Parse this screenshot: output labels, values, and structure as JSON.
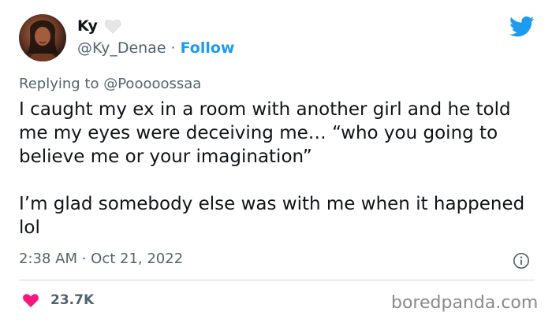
{
  "author": {
    "name": "Ky",
    "handle": "@Ky_Denae",
    "separator": "·",
    "follow_label": "Follow"
  },
  "reply": {
    "prefix": "Replying to",
    "to_handle": "@Pooooossaa"
  },
  "tweet": {
    "text": "I caught my ex in a room with another girl and he told me my eyes were deceiving me… “who you going to believe me or your imagination”\n\nI’m glad somebody else was with me when it happened lol",
    "timestamp": "2:38 AM · Oct 21, 2022"
  },
  "engagement": {
    "likes": "23.7K"
  },
  "watermark": "boredpanda.com",
  "colors": {
    "accent": "#1d9bf0",
    "like": "#f91880",
    "muted": "#536471",
    "text": "#0f1419"
  },
  "icons": {
    "verified_heart": "white-heart-icon",
    "brand": "twitter-bird-icon",
    "info": "info-icon",
    "like": "heart-icon"
  }
}
